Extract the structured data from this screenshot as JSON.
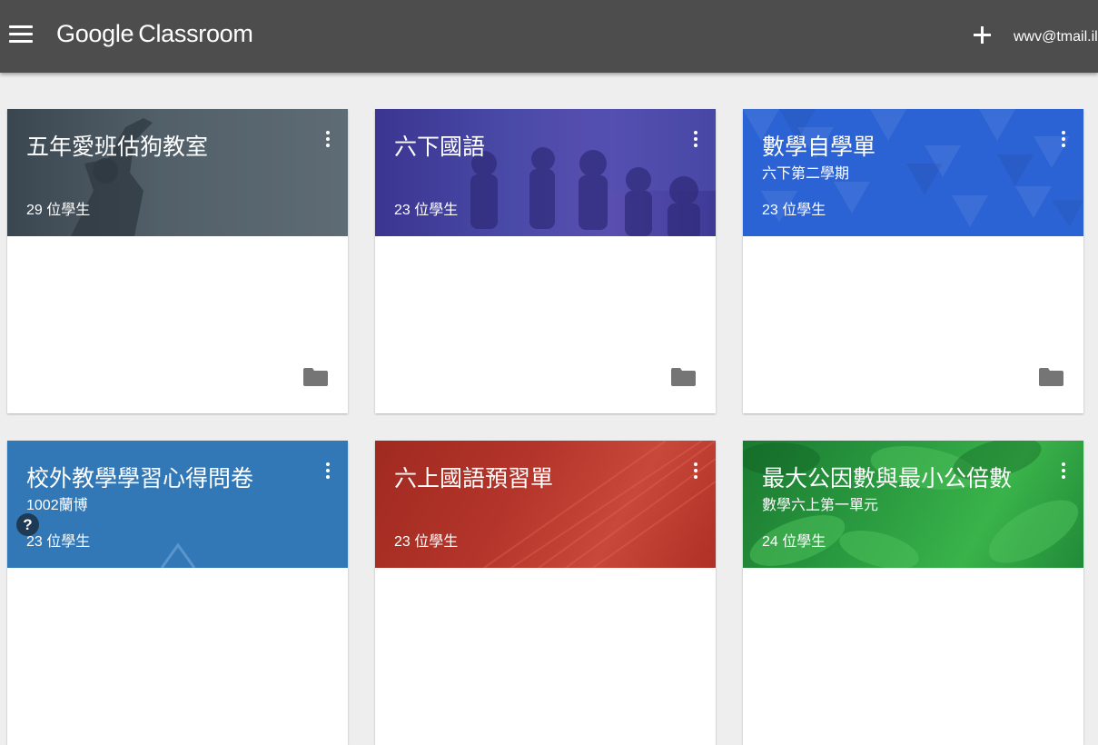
{
  "header": {
    "brand_google": "Google",
    "brand_classroom": "Classroom",
    "account": "wwv@tmail.il"
  },
  "cards": [
    {
      "title": "五年愛班估狗教室",
      "subtitle": "",
      "students": "29 位學生"
    },
    {
      "title": "六下國語",
      "subtitle": "",
      "students": "23 位學生"
    },
    {
      "title": "數學自學單",
      "subtitle": "六下第二學期",
      "students": "23 位學生"
    },
    {
      "title": "校外教學學習心得問卷",
      "subtitle": "1002蘭博",
      "students": "23 位學生"
    },
    {
      "title": "六上國語預習單",
      "subtitle": "",
      "students": "23 位學生"
    },
    {
      "title": "最大公因數與最小公倍數",
      "subtitle": "數學六上第一單元",
      "students": "24 位學生"
    }
  ],
  "help": {
    "label": "?"
  },
  "colors": {
    "topbar": "#4d4d4d",
    "background": "#eeeeee",
    "card_blue": "#2c63d4",
    "card_steel": "#3277b6",
    "card_red": "#b3342a",
    "card_green": "#2a9a40",
    "card_purple": "#4a4aa8",
    "icon_gray": "#757575"
  },
  "icons": {
    "menu": "menu-icon",
    "add": "add-icon",
    "more": "more-vert-icon",
    "folder": "folder-icon",
    "help": "help-icon"
  }
}
